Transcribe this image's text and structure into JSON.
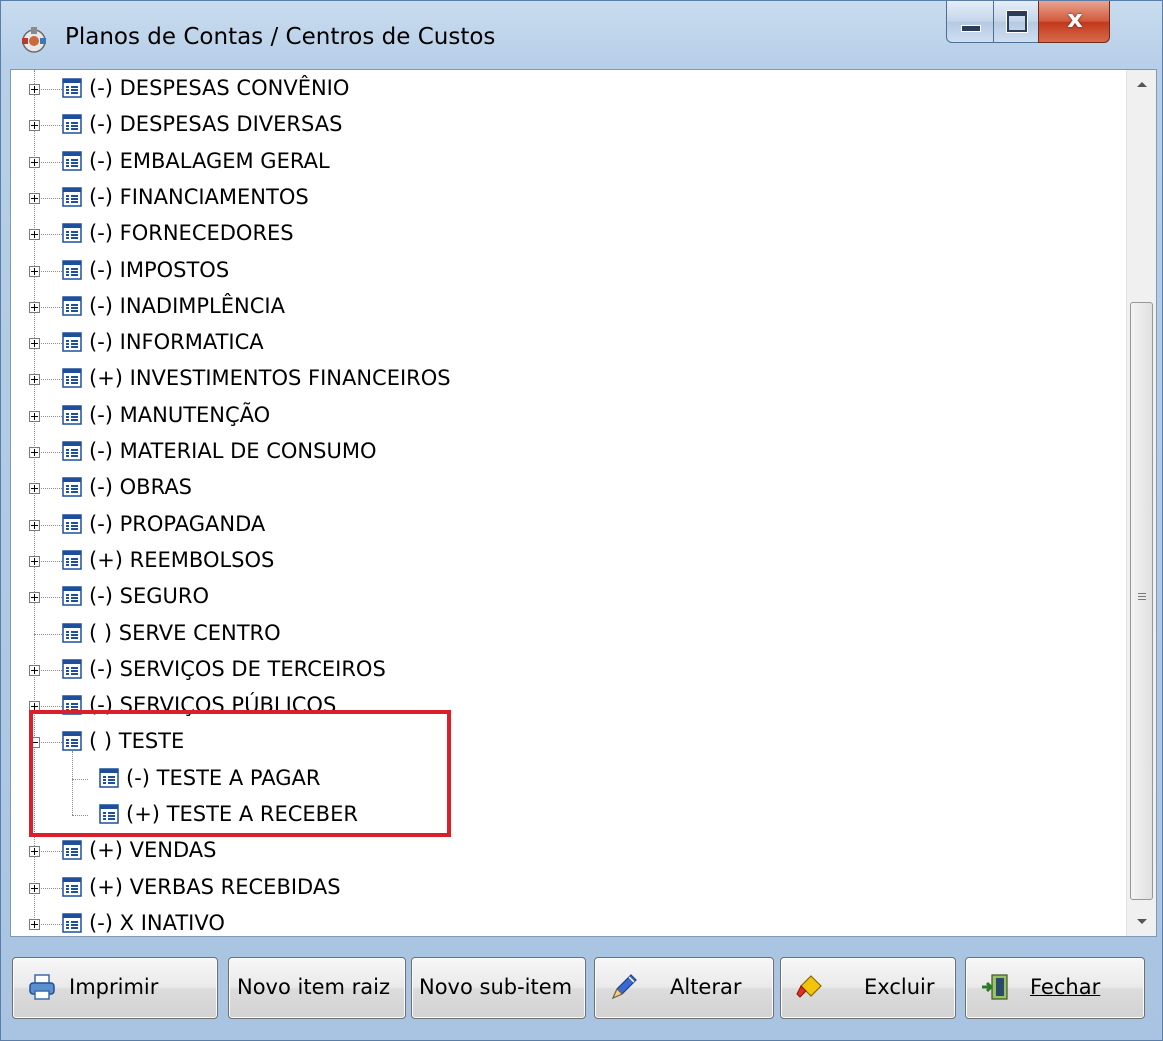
{
  "window": {
    "title": "Planos de Contas / Centros de Custos",
    "close_glyph": "x",
    "colors": {
      "highlight": "#d81f2a",
      "icon_blue": "#1f4f9a"
    }
  },
  "tree": {
    "items": [
      {
        "label": "(-) DESPESAS CONVÊNIO",
        "expander": "plus",
        "level": 0
      },
      {
        "label": "(-) DESPESAS DIVERSAS",
        "expander": "plus",
        "level": 0
      },
      {
        "label": "(-) EMBALAGEM GERAL",
        "expander": "plus",
        "level": 0
      },
      {
        "label": "(-) FINANCIAMENTOS",
        "expander": "plus",
        "level": 0
      },
      {
        "label": "(-) FORNECEDORES",
        "expander": "plus",
        "level": 0
      },
      {
        "label": "(-) IMPOSTOS",
        "expander": "plus",
        "level": 0
      },
      {
        "label": "(-) INADIMPLÊNCIA",
        "expander": "plus",
        "level": 0
      },
      {
        "label": "(-) INFORMATICA",
        "expander": "plus",
        "level": 0
      },
      {
        "label": "(+) INVESTIMENTOS FINANCEIROS",
        "expander": "plus",
        "level": 0
      },
      {
        "label": "(-) MANUTENÇÃO",
        "expander": "plus",
        "level": 0
      },
      {
        "label": "(-) MATERIAL DE CONSUMO",
        "expander": "plus",
        "level": 0
      },
      {
        "label": "(-) OBRAS",
        "expander": "plus",
        "level": 0
      },
      {
        "label": "(-) PROPAGANDA",
        "expander": "plus",
        "level": 0
      },
      {
        "label": "(+) REEMBOLSOS",
        "expander": "plus",
        "level": 0
      },
      {
        "label": "(-) SEGURO",
        "expander": "plus",
        "level": 0
      },
      {
        "label": "( ) SERVE CENTRO",
        "expander": "none",
        "level": 0
      },
      {
        "label": "(-) SERVIÇOS DE TERCEIROS",
        "expander": "plus",
        "level": 0
      },
      {
        "label": "(-) SERVIÇOS PÚBLICOS",
        "expander": "plus",
        "level": 0
      },
      {
        "label": "( ) TESTE",
        "expander": "minus",
        "level": 0
      },
      {
        "label": "(-) TESTE A PAGAR",
        "expander": "none",
        "level": 1
      },
      {
        "label": "(+) TESTE A RECEBER",
        "expander": "none",
        "level": 1
      },
      {
        "label": "(+) VENDAS",
        "expander": "plus",
        "level": 0
      },
      {
        "label": "(+) VERBAS RECEBIDAS",
        "expander": "plus",
        "level": 0
      },
      {
        "label": "(-) X INATIVO",
        "expander": "plus",
        "level": 0
      }
    ]
  },
  "buttons": {
    "print": {
      "label": "Imprimir",
      "icon": "printer-icon"
    },
    "new_root": {
      "label": "Novo item raiz"
    },
    "new_sub": {
      "label": "Novo sub-item"
    },
    "edit": {
      "label": "Alterar",
      "icon": "pencil-icon"
    },
    "delete": {
      "label": "Excluir",
      "icon": "eraser-icon"
    },
    "close": {
      "label": "Fechar",
      "icon": "exit-door-icon"
    }
  }
}
